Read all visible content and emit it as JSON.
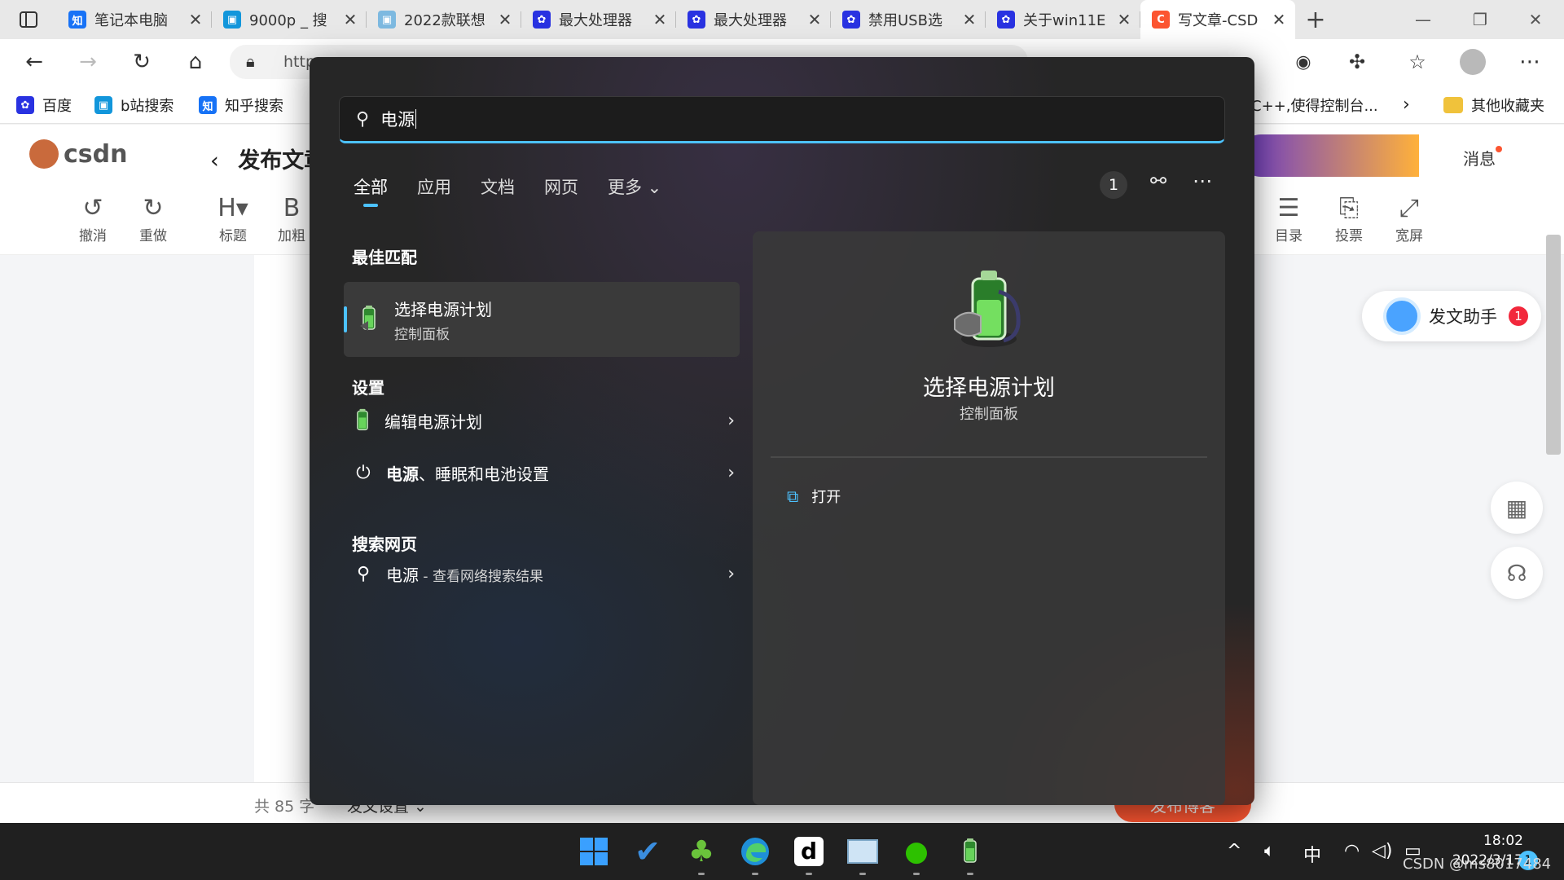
{
  "browser": {
    "tabs": [
      {
        "label": "笔记本电脑",
        "icon": "zhihu-icon",
        "color": "#1772f6",
        "glyph": "知"
      },
      {
        "label": "9000p _ 搜",
        "icon": "bilibili-icon",
        "color": "#1296db",
        "glyph": "▣"
      },
      {
        "label": "2022款联想",
        "icon": "bilibili-icon",
        "color": "#7db9e0",
        "glyph": "▣"
      },
      {
        "label": "最大处理器",
        "icon": "baidu-icon",
        "color": "#2932e1",
        "glyph": "✿"
      },
      {
        "label": "最大处理器",
        "icon": "baidu-icon",
        "color": "#2932e1",
        "glyph": "✿"
      },
      {
        "label": "禁用USB选",
        "icon": "baidu-icon",
        "color": "#2932e1",
        "glyph": "✿"
      },
      {
        "label": "关于win11E",
        "icon": "baidu-icon",
        "color": "#2932e1",
        "glyph": "✿"
      },
      {
        "label": "写文章-CSD",
        "icon": "csdn-icon",
        "color": "#fc5531",
        "glyph": "C"
      }
    ],
    "url": "http",
    "favorites": [
      {
        "label": "百度",
        "color": "#2932e1",
        "glyph": "✿"
      },
      {
        "label": "b站搜索",
        "color": "#1296db",
        "glyph": "▣"
      },
      {
        "label": "知乎搜索",
        "color": "#1772f6",
        "glyph": "知"
      }
    ],
    "fav_truncated": "C++,使得控制台...",
    "fav_other": "其他收藏夹"
  },
  "csdn": {
    "logo": "csdn",
    "page_title": "发布文章",
    "message": "消息",
    "toolbar_left": [
      {
        "icon": "↺",
        "label": "撤消"
      },
      {
        "icon": "↻",
        "label": "重做"
      },
      {
        "icon": "H▾",
        "label": "标题"
      },
      {
        "icon": "B",
        "label": "加粗"
      }
    ],
    "toolbar_right": [
      {
        "icon": "☰",
        "label": "目录"
      },
      {
        "icon": "⎘",
        "label": "投票"
      },
      {
        "icon": "⤢",
        "label": "宽屏"
      }
    ],
    "helper_label": "发文助手",
    "helper_badge": "1",
    "word_count": "共 85 字",
    "post_settings": "发文设置",
    "publish": "发布博客"
  },
  "search": {
    "query": "电源",
    "tabs": [
      "全部",
      "应用",
      "文档",
      "网页",
      "更多"
    ],
    "active_tab": 0,
    "result_count": "1",
    "best_match_heading": "最佳匹配",
    "best_match": {
      "title": "选择电源计划",
      "subtitle": "控制面板"
    },
    "settings_heading": "设置",
    "settings": [
      {
        "label": "编辑电源计划",
        "icon": "battery-icon"
      },
      {
        "label_bold": "电源",
        "label_rest": "、睡眠和电池设置",
        "icon": "power-icon"
      }
    ],
    "web_heading": "搜索网页",
    "web_item": {
      "query": "电源",
      "suffix": " - 查看网络搜索结果"
    },
    "preview": {
      "title": "选择电源计划",
      "subtitle": "控制面板",
      "action": "打开"
    },
    "accent": "#4cc2ff"
  },
  "taskbar": {
    "ime": "中",
    "time": "18:02",
    "date": "2022/3/17",
    "notifications": "1",
    "watermark": "CSDN @ms8017484"
  }
}
